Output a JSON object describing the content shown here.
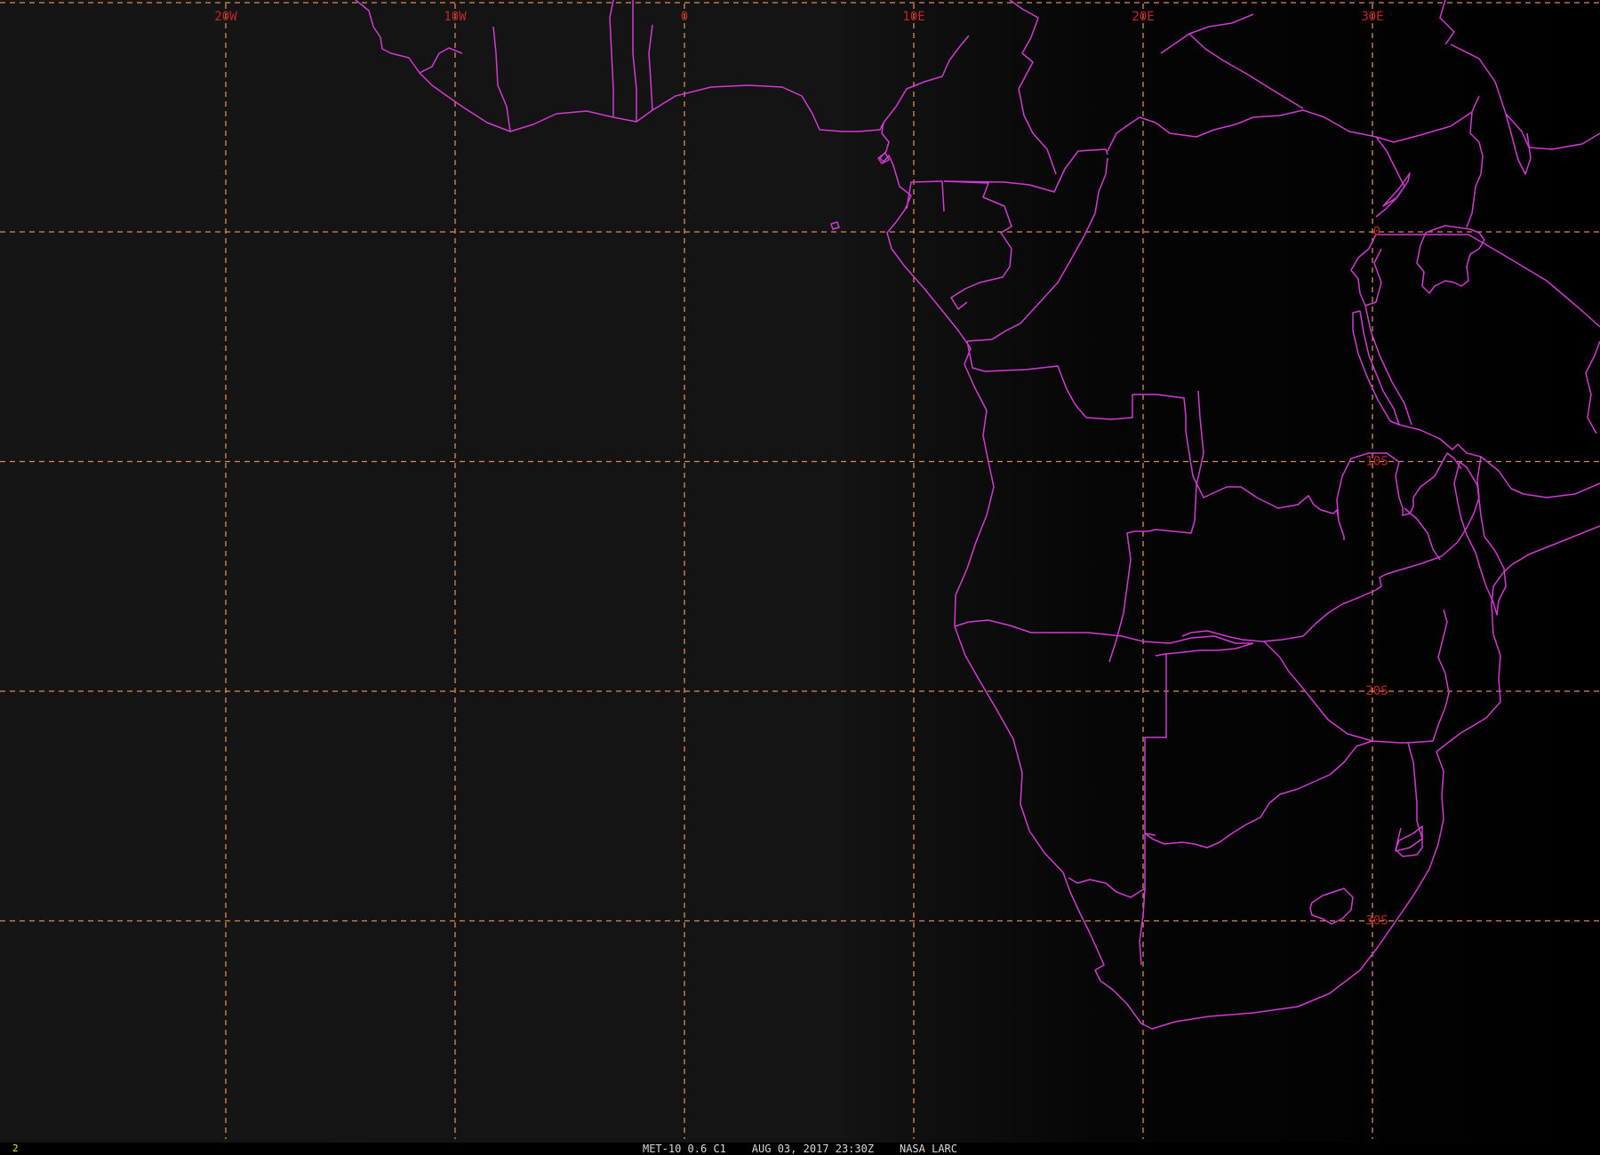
{
  "image": {
    "colors": {
      "background_west": "#151515",
      "background_east": "#000000",
      "coastline": "#d23ad2",
      "gridline": "#d68d55",
      "grid_label": "#c42525",
      "frame_number": "#e8e84a",
      "status_text": "#d8d8d8"
    }
  },
  "grid": {
    "lon_labels": [
      {
        "id": "20w",
        "text": "20W",
        "lon": -20
      },
      {
        "id": "10w",
        "text": "10W",
        "lon": -10
      },
      {
        "id": "0",
        "text": "0",
        "lon": 0
      },
      {
        "id": "10e",
        "text": "10E",
        "lon": 10
      },
      {
        "id": "20e",
        "text": "20E",
        "lon": 20
      },
      {
        "id": "30e",
        "text": "30E",
        "lon": 30
      }
    ],
    "lat_labels": [
      {
        "id": "0",
        "text": "0",
        "lat": 0
      },
      {
        "id": "10s",
        "text": "10S",
        "lat": -10
      },
      {
        "id": "20s",
        "text": "20S",
        "lat": -20
      },
      {
        "id": "30s",
        "text": "30S",
        "lat": -30
      }
    ]
  },
  "status_bar": {
    "frame_number": "2",
    "caption": "MET-10 0.6 C1    AUG 03, 2017 23:30Z    NASA LARC"
  }
}
